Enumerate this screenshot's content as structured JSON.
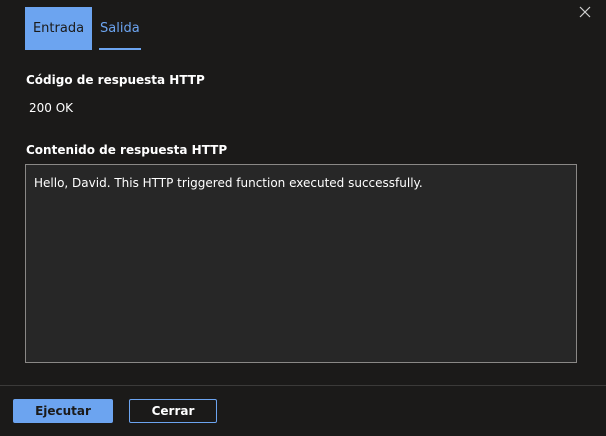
{
  "tabs": {
    "input_label": "Entrada",
    "output_label": "Salida"
  },
  "response": {
    "code_label": "Código de respuesta HTTP",
    "code_value": "200 OK",
    "content_label": "Contenido de respuesta HTTP",
    "content_value": "Hello, David. This HTTP triggered function executed successfully."
  },
  "footer": {
    "run_label": "Ejecutar",
    "close_label": "Cerrar"
  },
  "icons": {
    "close": "close-icon"
  },
  "colors": {
    "background": "#1b1a19",
    "accent": "#6ca4f0",
    "box_background": "#272727",
    "box_border": "#8a8886"
  }
}
